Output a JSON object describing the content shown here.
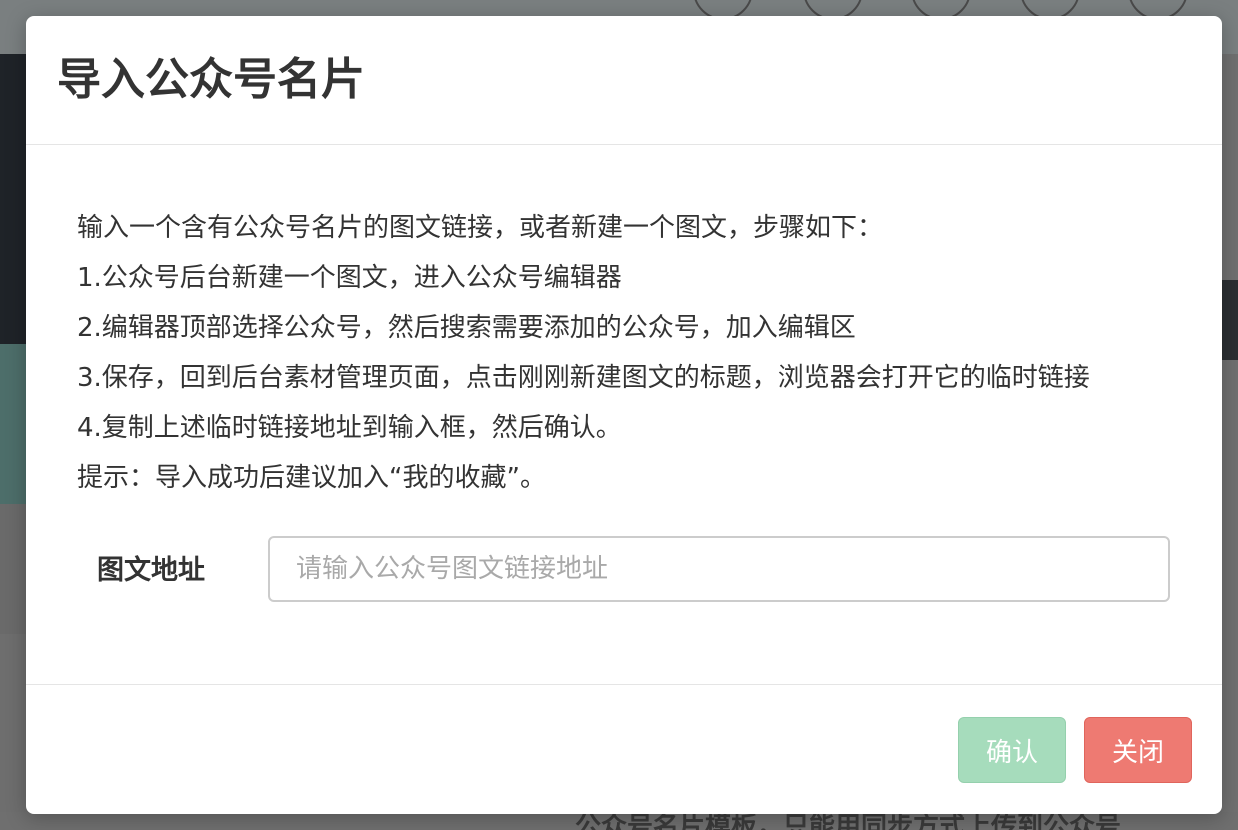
{
  "dialog": {
    "title": "导入公众号名片",
    "instructions": [
      "输入一个含有公众号名片的图文链接，或者新建一个图文，步骤如下：",
      "1.公众号后台新建一个图文，进入公众号编辑器",
      "2.编辑器顶部选择公众号，然后搜索需要添加的公众号，加入编辑区",
      "3.保存，回到后台素材管理页面，点击刚刚新建图文的标题，浏览器会打开它的临时链接",
      "4.复制上述临时链接地址到输入框，然后确认。",
      "提示：导入成功后建议加入“我的收藏”。"
    ],
    "form": {
      "url_label": "图文地址",
      "url_value": "",
      "url_placeholder": "请输入公众号图文链接地址"
    },
    "buttons": {
      "confirm_label": "确认",
      "close_label": "关闭"
    }
  },
  "background": {
    "partial_text": "公众号名片模板，只能用同步方式上传到公众号"
  },
  "colors": {
    "confirm_button": "#a6dcbc",
    "close_button": "#ee7a72",
    "text": "#333333",
    "placeholder": "#a9a9a9"
  }
}
